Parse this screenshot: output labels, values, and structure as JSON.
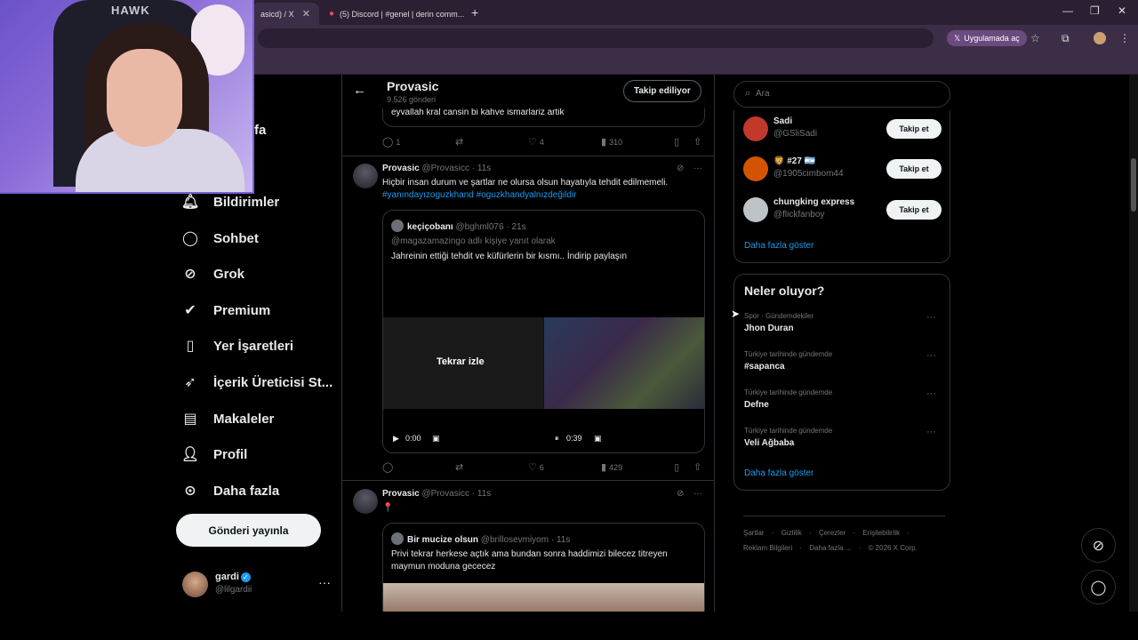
{
  "browser": {
    "tabs": [
      {
        "title": "asicd) / X"
      },
      {
        "title": "(5) Discord | #genel | derin comm..."
      }
    ],
    "app_pill": "Uygulamada aç"
  },
  "webcam": {
    "logo": "HAWK"
  },
  "nav": {
    "partial_label": "fa",
    "items": [
      {
        "label": "Bildirimler",
        "icon": "bell-icon"
      },
      {
        "label": "Sohbet",
        "icon": "chat-icon"
      },
      {
        "label": "Grok",
        "icon": "grok-icon"
      },
      {
        "label": "Premium",
        "icon": "premium-icon"
      },
      {
        "label": "Yer İşaretleri",
        "icon": "bookmark-icon"
      },
      {
        "label": "İçerik Üreticisi St...",
        "icon": "rocket-icon"
      },
      {
        "label": "Makaleler",
        "icon": "articles-icon"
      },
      {
        "label": "Profil",
        "icon": "person-icon"
      },
      {
        "label": "Daha fazla",
        "icon": "more-circle-icon"
      }
    ],
    "post_button": "Gönderi yayınla",
    "profile": {
      "name": "gardi",
      "handle": "@lilgardii"
    }
  },
  "header": {
    "title": "Provasic",
    "subtitle": "9.526 gönderi",
    "follow_button": "Takip ediliyor"
  },
  "prev_tweet": {
    "quote_text": "eyvallah kral cansin bi kahve ismarlariz artik",
    "stats": {
      "replies": "1",
      "likes": "4",
      "views": "310"
    }
  },
  "tweet1": {
    "name": "Provasic",
    "handle": "@Provasicc",
    "time": "· 11s",
    "text": "Hiçbir insan durum ve şartlar ne olursa olsun hayatıyla tehdit edilmemeli.",
    "hashtags": "#yanındayızoguzkhand #oguzkhandyalnızdeğildir",
    "quote": {
      "name": "keçiçobanı",
      "handle": "@bghml076",
      "time": "· 21s",
      "reply_to": "@magazamazingo adlı kişiye yanıt olarak",
      "text": "Jahreinin ettiği tehdit ve küfürlerin bir kısmı.. İndirip paylaşın",
      "replay_label": "Tekrar izle",
      "time_current": "0:00",
      "time_total": "0:39"
    },
    "stats": {
      "likes": "6",
      "views": "429"
    }
  },
  "tweet2": {
    "name": "Provasic",
    "handle": "@Provasicc",
    "time": "· 11s",
    "text": "📍",
    "quote": {
      "name": "Bir mucize olsun",
      "handle": "@brillosevmiyom",
      "time": "· 11s",
      "text": "Privi tekrar herkese açtık ama bundan sonra haddimizi bilecez titreyen maymun moduna gececez"
    }
  },
  "right": {
    "search_placeholder": "Ara",
    "who_to_follow": [
      {
        "name": "Sadi",
        "handle": "@GSliSadi",
        "button": "Takip et",
        "color": "#c0392b"
      },
      {
        "name": "🦁 #27 🇦🇷",
        "handle": "@1905cimbom44",
        "button": "Takip et",
        "color": "#d35400"
      },
      {
        "name": "chungking express",
        "handle": "@flickfanboy",
        "button": "Takip et",
        "color": "#bdc3c7"
      }
    ],
    "show_more": "Daha fazla göster",
    "trends_title": "Neler oluyor?",
    "trends": [
      {
        "meta": "Spor · Gündemdekiler",
        "name": "Jhon Duran"
      },
      {
        "meta": "Türkiye tarihinde gündemde",
        "name": "#sapanca"
      },
      {
        "meta": "Türkiye tarihinde gündemde",
        "name": "Defne"
      },
      {
        "meta": "Türkiye tarihinde gündemde",
        "name": "Veli Ağbaba"
      }
    ],
    "trends_show_more": "Daha fazla göster",
    "footer_row1": [
      "Şartlar",
      "·",
      "Gizlilik",
      "·",
      "Çerezler",
      "·",
      "Erişilebilirlik",
      "·"
    ],
    "footer_row2": [
      "Reklam Bilgileri",
      "·",
      "Daha fazla ...",
      "·",
      "© 2026 X Corp."
    ]
  }
}
